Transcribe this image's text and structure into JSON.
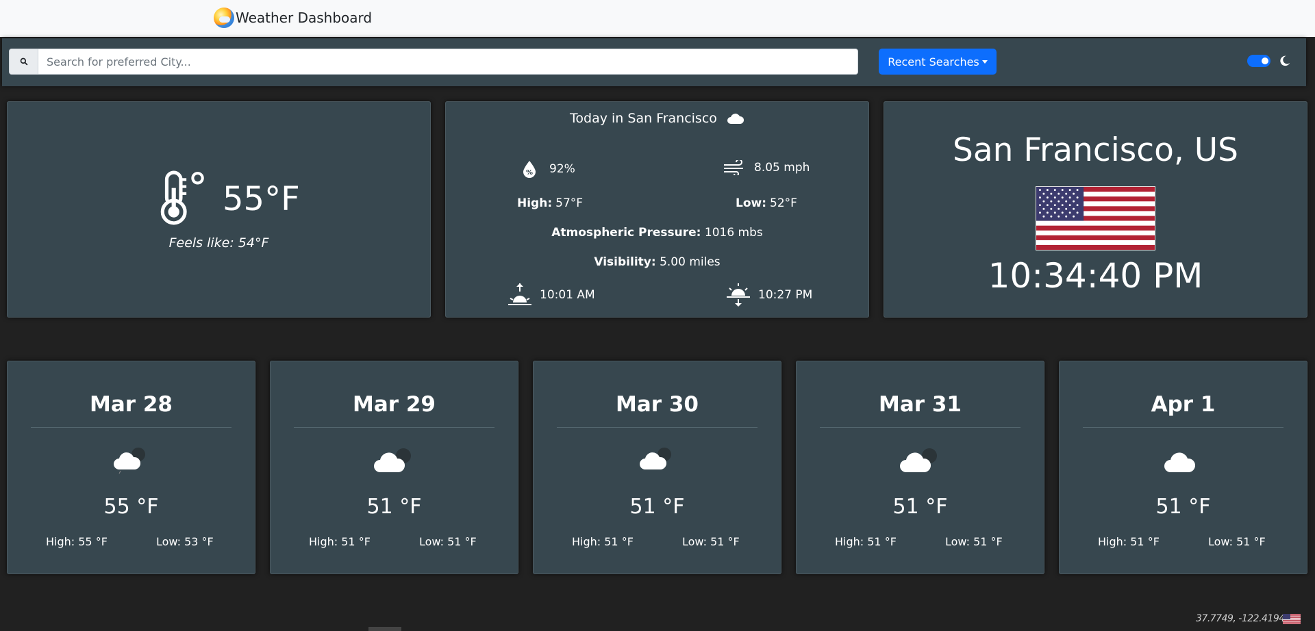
{
  "app": {
    "title": "Weather Dashboard"
  },
  "search": {
    "placeholder": "Search for preferred City...",
    "value": ""
  },
  "recent_searches": {
    "label": "Recent Searches"
  },
  "current": {
    "temperature": "55°F",
    "feels_like": "Feels like: 54°F"
  },
  "today": {
    "title": "Today in San Francisco",
    "humidity": "92%",
    "wind": "8.05 mph",
    "high_label": "High:",
    "high": "57°F",
    "low_label": "Low:",
    "low": "52°F",
    "pressure_label": "Atmospheric Pressure:",
    "pressure": "1016 mbs",
    "visibility_label": "Visibility:",
    "visibility": "5.00 miles",
    "sunrise": "10:01 AM",
    "sunset": "10:27 PM"
  },
  "location": {
    "city": "San Francisco, US",
    "time": "10:34:40 PM"
  },
  "forecast": [
    {
      "date": "Mar 28",
      "temp": "55 °F",
      "high": "High: 55 °F",
      "low": "Low: 53 °F",
      "icon": "cloud-moon-icon"
    },
    {
      "date": "Mar 29",
      "temp": "51 °F",
      "high": "High: 51 °F",
      "low": "Low: 51 °F",
      "icon": "cloud-moon-icon"
    },
    {
      "date": "Mar 30",
      "temp": "51 °F",
      "high": "High: 51 °F",
      "low": "Low: 51 °F",
      "icon": "cloud-moon-icon"
    },
    {
      "date": "Mar 31",
      "temp": "51 °F",
      "high": "High: 51 °F",
      "low": "Low: 51 °F",
      "icon": "cloud-moon-icon"
    },
    {
      "date": "Apr 1",
      "temp": "51 °F",
      "high": "High: 51 °F",
      "low": "Low: 51 °F",
      "icon": "cloud-icon"
    }
  ],
  "footer": {
    "coordinates": "37.7749, -122.4194"
  },
  "colors": {
    "card_bg": "#37474f",
    "page_bg": "#212121",
    "accent": "#0d6efd"
  }
}
